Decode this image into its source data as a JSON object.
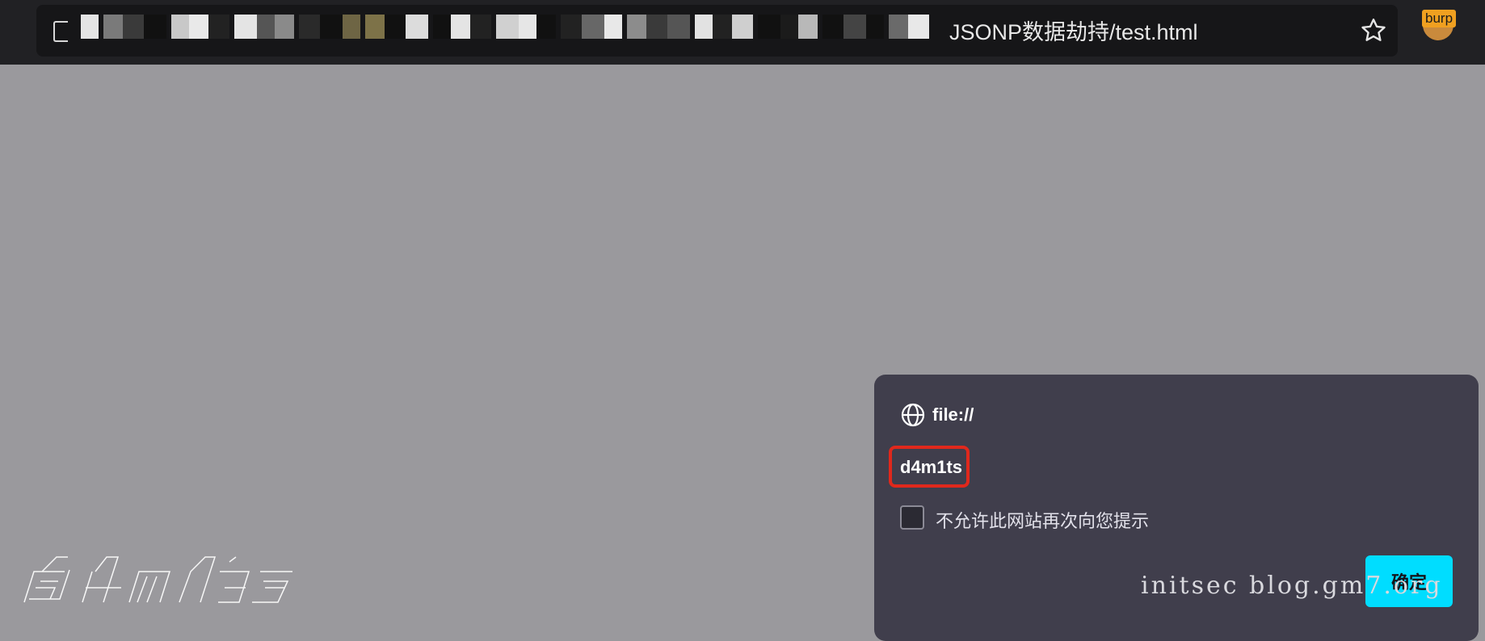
{
  "browser": {
    "url_visible_suffix": "JSONP数据劫持/test.html",
    "extension_badge": "burp"
  },
  "dialog": {
    "origin": "file://",
    "message": "d4m1ts",
    "checkbox_label": "不允许此网站再次向您提示",
    "ok_button": "确定"
  },
  "watermark": {
    "text": "initsec blog.gm7.org",
    "logo_text": "d4m1ts"
  },
  "colors": {
    "page_background": "#9a999d",
    "toolbar": "#212124",
    "dialog": "#403e4c",
    "accent": "#00ddff",
    "highlight": "#e0281c"
  },
  "icons": [
    "tab-icon",
    "star-icon",
    "burp-extension-icon",
    "globe-icon"
  ]
}
